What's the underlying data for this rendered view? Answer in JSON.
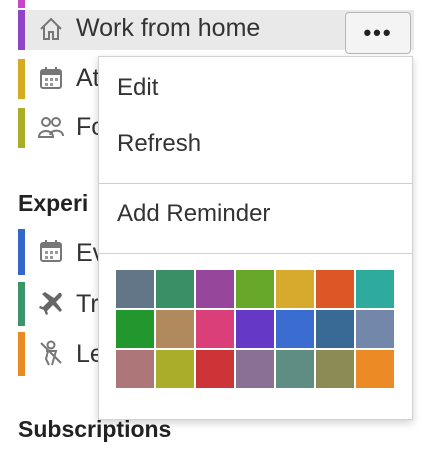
{
  "list": {
    "items": [
      {
        "label": "Work from home",
        "icon": "house-icon",
        "bar_color": "#8f44c7"
      },
      {
        "label": "At",
        "icon": "calendar-icon",
        "bar_color": "#d6ac1f"
      },
      {
        "label": "Fo",
        "icon": "group-icon",
        "bar_color": "#a9ad28"
      },
      {
        "label": "Ev",
        "icon": "calendar-icon",
        "bar_color": "#3566c9"
      },
      {
        "label": "Tr",
        "icon": "airplane-icon",
        "bar_color": "#3b946b"
      },
      {
        "label": "Le",
        "icon": "person-icon",
        "bar_color": "#e98a24"
      }
    ],
    "section_experiences": "Experi",
    "section_subscriptions": "Subscriptions"
  },
  "more_button": {
    "label": "•••"
  },
  "menu": {
    "edit": "Edit",
    "refresh": "Refresh",
    "add_reminder": "Add Reminder",
    "colors": [
      "#627688",
      "#3a8f66",
      "#96469b",
      "#67a82a",
      "#d7aa2e",
      "#dd5626",
      "#2eab9c",
      "#22972e",
      "#b08a5c",
      "#da3f7a",
      "#6538c6",
      "#3b6dd0",
      "#386a95",
      "#7387ab",
      "#ad7679",
      "#a9ad2a",
      "#cc3438",
      "#8a7093",
      "#5e8e83",
      "#8b8b56",
      "#ec8b26"
    ]
  }
}
